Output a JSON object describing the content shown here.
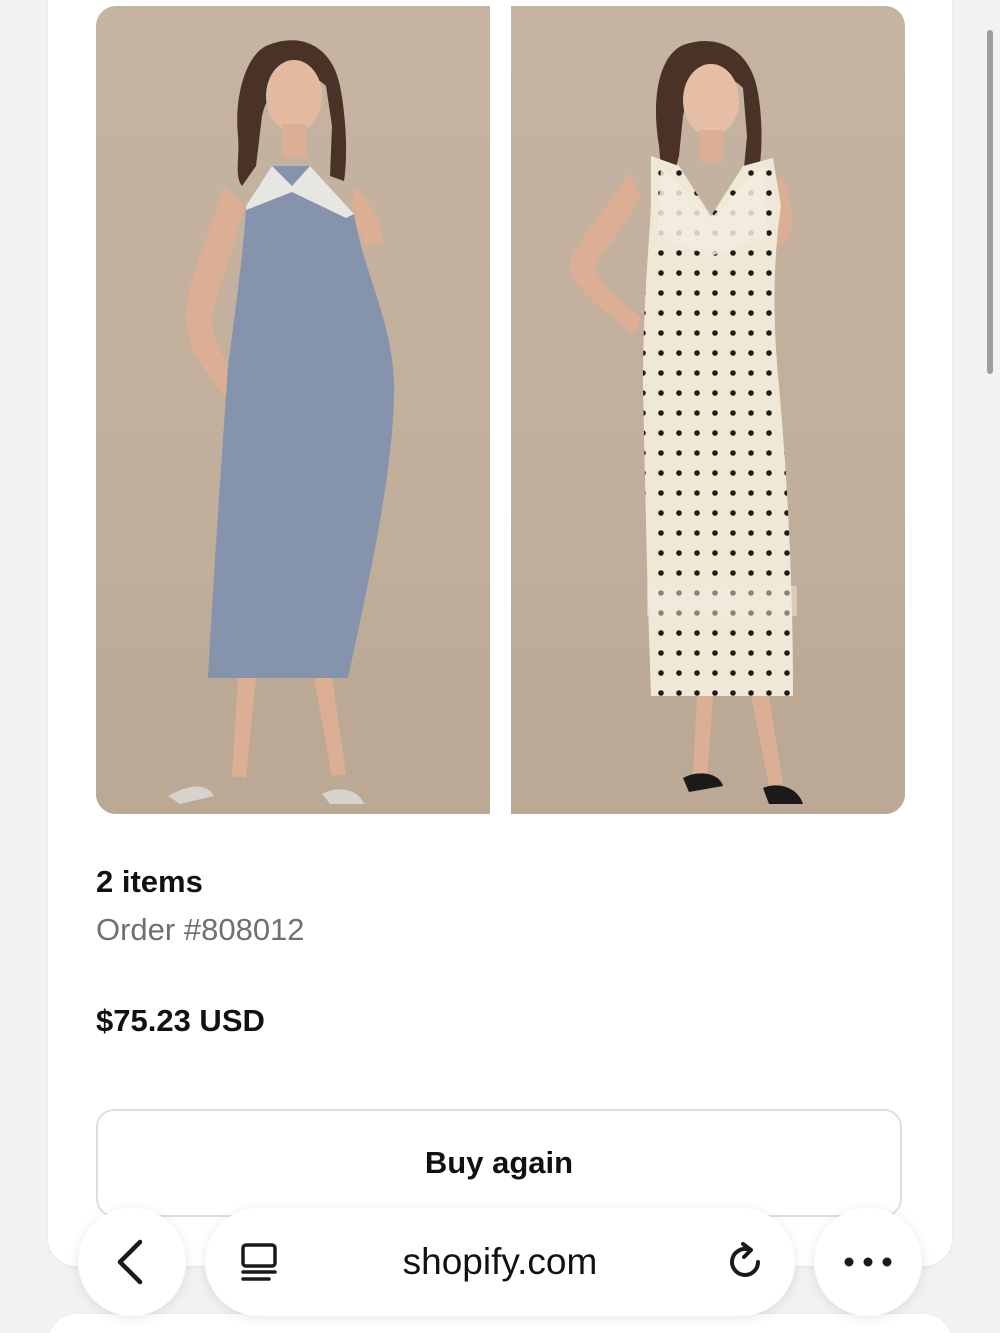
{
  "order": {
    "items_count": "2 items",
    "order_number": "Order #808012",
    "total": "$75.23 USD",
    "buy_again_label": "Buy again"
  },
  "products": [
    {
      "description": "blue-satin-halter-dress-image",
      "dress_color": "#8593ad"
    },
    {
      "description": "polka-dot-cream-dress-image",
      "dress_color": "#efe8d7"
    }
  ],
  "browser": {
    "url": "shopify.com",
    "icons": {
      "back": "chevron-left-icon",
      "tabs": "tabs-icon",
      "reload": "reload-icon",
      "more": "more-dots-icon"
    }
  },
  "colors": {
    "background": "#f2f2f3",
    "card": "#ffffff",
    "text_primary": "#111111",
    "text_secondary": "#707070",
    "photo_backdrop": "#c4b3a1"
  }
}
